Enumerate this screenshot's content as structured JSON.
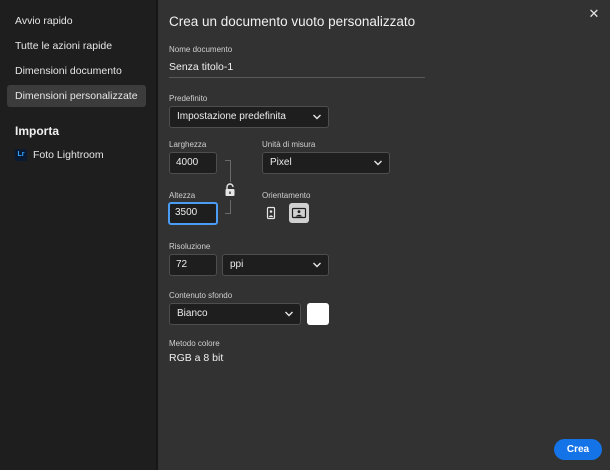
{
  "sidebar": {
    "items": [
      {
        "label": "Avvio rapido"
      },
      {
        "label": "Tutte le azioni rapide"
      },
      {
        "label": "Dimensioni documento"
      },
      {
        "label": "Dimensioni personalizzate",
        "selected": true
      }
    ],
    "import_title": "Importa",
    "import_items": [
      {
        "badge": "Lr",
        "label": "Foto Lightroom"
      }
    ]
  },
  "dialog": {
    "title": "Crea un documento vuoto personalizzato",
    "close_glyph": "✕",
    "doc_name": {
      "label": "Nome documento",
      "value": "Senza titolo-1"
    },
    "preset": {
      "label": "Predefinito",
      "value": "Impostazione predefinita"
    },
    "width": {
      "label": "Larghezza",
      "value": "4000"
    },
    "height": {
      "label": "Altezza",
      "value": "3500"
    },
    "unit": {
      "label": "Unità di misura",
      "value": "Pixel"
    },
    "orientation": {
      "label": "Orientamento",
      "selected": "landscape"
    },
    "resolution": {
      "label": "Risoluzione",
      "value": "72",
      "unit": "ppi"
    },
    "background": {
      "label": "Contenuto sfondo",
      "value": "Bianco",
      "color": "#ffffff"
    },
    "color_mode": {
      "label": "Metodo colore",
      "value": "RGB a 8 bit"
    },
    "create_label": "Crea"
  },
  "colors": {
    "accent": "#1473e6",
    "focus": "#4a9cf5",
    "lightroom": "#31a8ff"
  },
  "icons": [
    "close-icon",
    "chevron-down-icon",
    "lock-icon",
    "portrait-icon",
    "landscape-icon",
    "lightroom-icon"
  ]
}
